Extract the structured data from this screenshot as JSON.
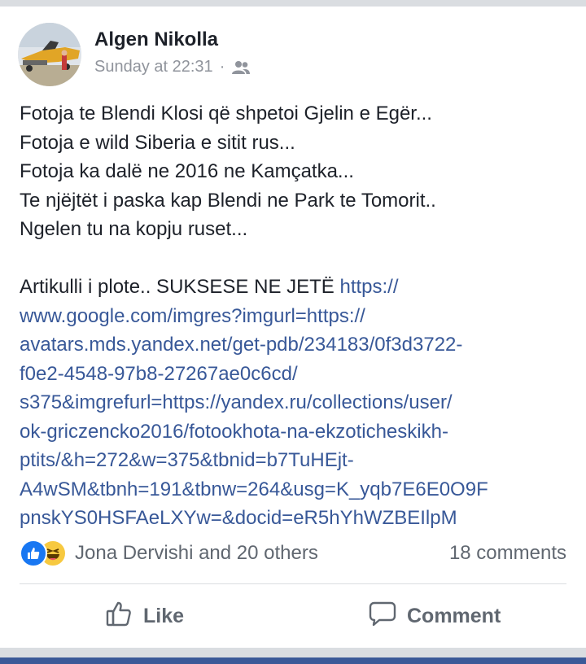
{
  "post": {
    "author": "Algen Nikolla",
    "timestamp": "Sunday at 22:31",
    "separator": "·",
    "audience_icon": "friends-icon",
    "lines": [
      "Fotoja te Blendi Klosi që shpetoi Gjelin e Egër...",
      "Fotoja e wild Siberia  e sitit rus...",
      "Fotoja ka dalë ne 2016 ne Kamçatka...",
      "Te njëjtët i paska kap Blendi ne Park te Tomorit..",
      "Ngelen tu na kopju ruset..."
    ],
    "article_prefix": "Artikulli i plote.. SUKSESE NE JETË ",
    "link_text": "https://\nwww.google.com/imgres?imgurl=https://\navatars.mds.yandex.net/get-pdb/234183/0f3d3722-\nf0e2-4548-97b8-27267ae0c6cd/\ns375&imgrefurl=https://yandex.ru/collections/user/\nok-griczencko2016/fotookhota-na-ekzoticheskikh-\nptits/&h=272&w=375&tbnid=b7TuHEjt-\nA4wSM&tbnh=191&tbnw=264&usg=K_yqb7E6E0O9F\npnskYS0HSFAeLXYw=&docid=eR5hYhWZBEIlpM"
  },
  "reactions": {
    "icons": [
      "like-icon",
      "haha-icon"
    ],
    "names": "Jona Dervishi and 20 others",
    "comments": "18 comments"
  },
  "actions": {
    "like_label": "Like",
    "comment_label": "Comment"
  },
  "colors": {
    "link": "#385898",
    "like_blue": "#1877f2",
    "haha_yellow": "#f7c940",
    "brand_bar": "#3b5998",
    "muted_text": "#606770"
  }
}
